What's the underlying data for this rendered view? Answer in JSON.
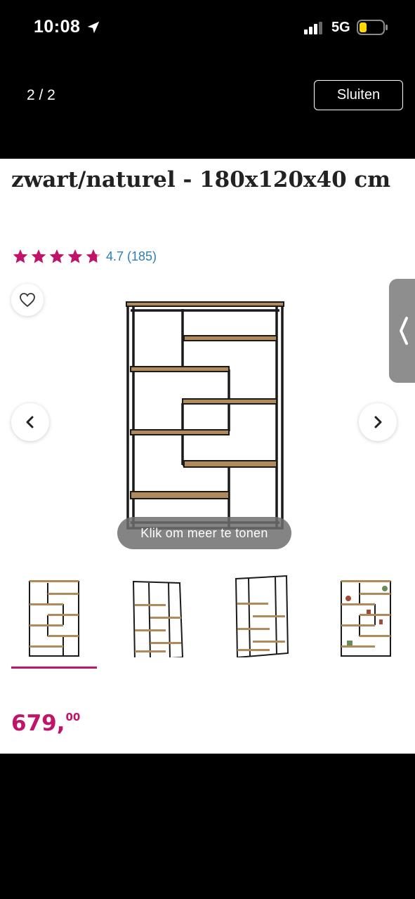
{
  "status_bar": {
    "time": "10:08",
    "network": "5G"
  },
  "viewer": {
    "page_counter": "2 / 2",
    "close_label": "Sluiten"
  },
  "product": {
    "title": "zwart/naturel - 180x120x40 cm",
    "rating_text": "4.7 (185)",
    "rating_value": 4.7,
    "price_main": "679,",
    "price_cents": "00",
    "show_more_label": "Klik om meer te tonen"
  },
  "thumbnails": {
    "count": 4,
    "selected_index": 0
  },
  "colors": {
    "accent": "#c0146a",
    "rating_text": "#2a7fb8",
    "background": "#ffffff",
    "chrome": "#000000"
  }
}
